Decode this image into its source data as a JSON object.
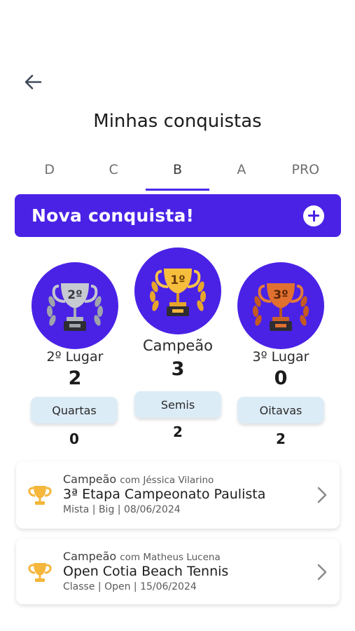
{
  "header": {
    "title": "Minhas conquistas"
  },
  "tabs": [
    {
      "label": "D"
    },
    {
      "label": "C"
    },
    {
      "label": "B",
      "active": true
    },
    {
      "label": "A"
    },
    {
      "label": "PRO"
    }
  ],
  "new_banner": {
    "label": "Nova conquista!"
  },
  "medals": {
    "second": {
      "rank_badge": "2º",
      "label": "2º Lugar",
      "count": "2"
    },
    "champion": {
      "rank_badge": "1º",
      "label": "Campeão",
      "count": "3"
    },
    "third": {
      "rank_badge": "3º",
      "label": "3º Lugar",
      "count": "0"
    }
  },
  "rounds": {
    "quartas": {
      "label": "Quartas",
      "count": "0"
    },
    "semis": {
      "label": "Semis",
      "count": "2"
    },
    "oitavas": {
      "label": "Oitavas",
      "count": "2"
    }
  },
  "achievements": [
    {
      "result": "Campeão",
      "partner": "com Jéssica Vilarino",
      "title": "3ª Etapa Campeonato Paulista",
      "meta": "Mista | Big | 08/06/2024"
    },
    {
      "result": "Campeão",
      "partner": "com Matheus Lucena",
      "title": "Open Cotia Beach Tennis",
      "meta": "Classe | Open | 15/06/2024"
    }
  ],
  "colors": {
    "accent": "#4a22e6",
    "gold": "#f4b63b",
    "silver": "#b9bcc3",
    "bronze": "#d0642a",
    "chip": "#dcecf7"
  }
}
